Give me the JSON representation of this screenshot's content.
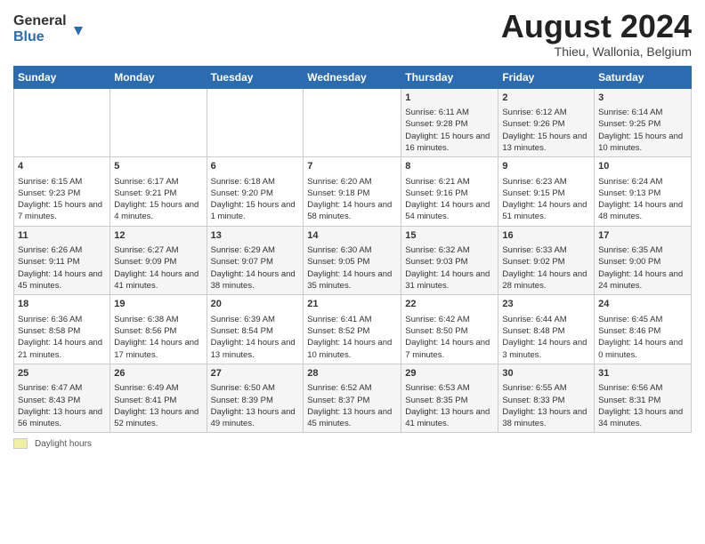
{
  "header": {
    "logo_line1": "General",
    "logo_line2": "Blue",
    "main_title": "August 2024",
    "subtitle": "Thieu, Wallonia, Belgium"
  },
  "days_of_week": [
    "Sunday",
    "Monday",
    "Tuesday",
    "Wednesday",
    "Thursday",
    "Friday",
    "Saturday"
  ],
  "weeks": [
    [
      {
        "num": "",
        "content": ""
      },
      {
        "num": "",
        "content": ""
      },
      {
        "num": "",
        "content": ""
      },
      {
        "num": "",
        "content": ""
      },
      {
        "num": "1",
        "content": "Sunrise: 6:11 AM\nSunset: 9:28 PM\nDaylight: 15 hours and 16 minutes."
      },
      {
        "num": "2",
        "content": "Sunrise: 6:12 AM\nSunset: 9:26 PM\nDaylight: 15 hours and 13 minutes."
      },
      {
        "num": "3",
        "content": "Sunrise: 6:14 AM\nSunset: 9:25 PM\nDaylight: 15 hours and 10 minutes."
      }
    ],
    [
      {
        "num": "4",
        "content": "Sunrise: 6:15 AM\nSunset: 9:23 PM\nDaylight: 15 hours and 7 minutes."
      },
      {
        "num": "5",
        "content": "Sunrise: 6:17 AM\nSunset: 9:21 PM\nDaylight: 15 hours and 4 minutes."
      },
      {
        "num": "6",
        "content": "Sunrise: 6:18 AM\nSunset: 9:20 PM\nDaylight: 15 hours and 1 minute."
      },
      {
        "num": "7",
        "content": "Sunrise: 6:20 AM\nSunset: 9:18 PM\nDaylight: 14 hours and 58 minutes."
      },
      {
        "num": "8",
        "content": "Sunrise: 6:21 AM\nSunset: 9:16 PM\nDaylight: 14 hours and 54 minutes."
      },
      {
        "num": "9",
        "content": "Sunrise: 6:23 AM\nSunset: 9:15 PM\nDaylight: 14 hours and 51 minutes."
      },
      {
        "num": "10",
        "content": "Sunrise: 6:24 AM\nSunset: 9:13 PM\nDaylight: 14 hours and 48 minutes."
      }
    ],
    [
      {
        "num": "11",
        "content": "Sunrise: 6:26 AM\nSunset: 9:11 PM\nDaylight: 14 hours and 45 minutes."
      },
      {
        "num": "12",
        "content": "Sunrise: 6:27 AM\nSunset: 9:09 PM\nDaylight: 14 hours and 41 minutes."
      },
      {
        "num": "13",
        "content": "Sunrise: 6:29 AM\nSunset: 9:07 PM\nDaylight: 14 hours and 38 minutes."
      },
      {
        "num": "14",
        "content": "Sunrise: 6:30 AM\nSunset: 9:05 PM\nDaylight: 14 hours and 35 minutes."
      },
      {
        "num": "15",
        "content": "Sunrise: 6:32 AM\nSunset: 9:03 PM\nDaylight: 14 hours and 31 minutes."
      },
      {
        "num": "16",
        "content": "Sunrise: 6:33 AM\nSunset: 9:02 PM\nDaylight: 14 hours and 28 minutes."
      },
      {
        "num": "17",
        "content": "Sunrise: 6:35 AM\nSunset: 9:00 PM\nDaylight: 14 hours and 24 minutes."
      }
    ],
    [
      {
        "num": "18",
        "content": "Sunrise: 6:36 AM\nSunset: 8:58 PM\nDaylight: 14 hours and 21 minutes."
      },
      {
        "num": "19",
        "content": "Sunrise: 6:38 AM\nSunset: 8:56 PM\nDaylight: 14 hours and 17 minutes."
      },
      {
        "num": "20",
        "content": "Sunrise: 6:39 AM\nSunset: 8:54 PM\nDaylight: 14 hours and 13 minutes."
      },
      {
        "num": "21",
        "content": "Sunrise: 6:41 AM\nSunset: 8:52 PM\nDaylight: 14 hours and 10 minutes."
      },
      {
        "num": "22",
        "content": "Sunrise: 6:42 AM\nSunset: 8:50 PM\nDaylight: 14 hours and 7 minutes."
      },
      {
        "num": "23",
        "content": "Sunrise: 6:44 AM\nSunset: 8:48 PM\nDaylight: 14 hours and 3 minutes."
      },
      {
        "num": "24",
        "content": "Sunrise: 6:45 AM\nSunset: 8:46 PM\nDaylight: 14 hours and 0 minutes."
      }
    ],
    [
      {
        "num": "25",
        "content": "Sunrise: 6:47 AM\nSunset: 8:43 PM\nDaylight: 13 hours and 56 minutes."
      },
      {
        "num": "26",
        "content": "Sunrise: 6:49 AM\nSunset: 8:41 PM\nDaylight: 13 hours and 52 minutes."
      },
      {
        "num": "27",
        "content": "Sunrise: 6:50 AM\nSunset: 8:39 PM\nDaylight: 13 hours and 49 minutes."
      },
      {
        "num": "28",
        "content": "Sunrise: 6:52 AM\nSunset: 8:37 PM\nDaylight: 13 hours and 45 minutes."
      },
      {
        "num": "29",
        "content": "Sunrise: 6:53 AM\nSunset: 8:35 PM\nDaylight: 13 hours and 41 minutes."
      },
      {
        "num": "30",
        "content": "Sunrise: 6:55 AM\nSunset: 8:33 PM\nDaylight: 13 hours and 38 minutes."
      },
      {
        "num": "31",
        "content": "Sunrise: 6:56 AM\nSunset: 8:31 PM\nDaylight: 13 hours and 34 minutes."
      }
    ]
  ],
  "footer": {
    "legend_label": "Daylight hours"
  }
}
